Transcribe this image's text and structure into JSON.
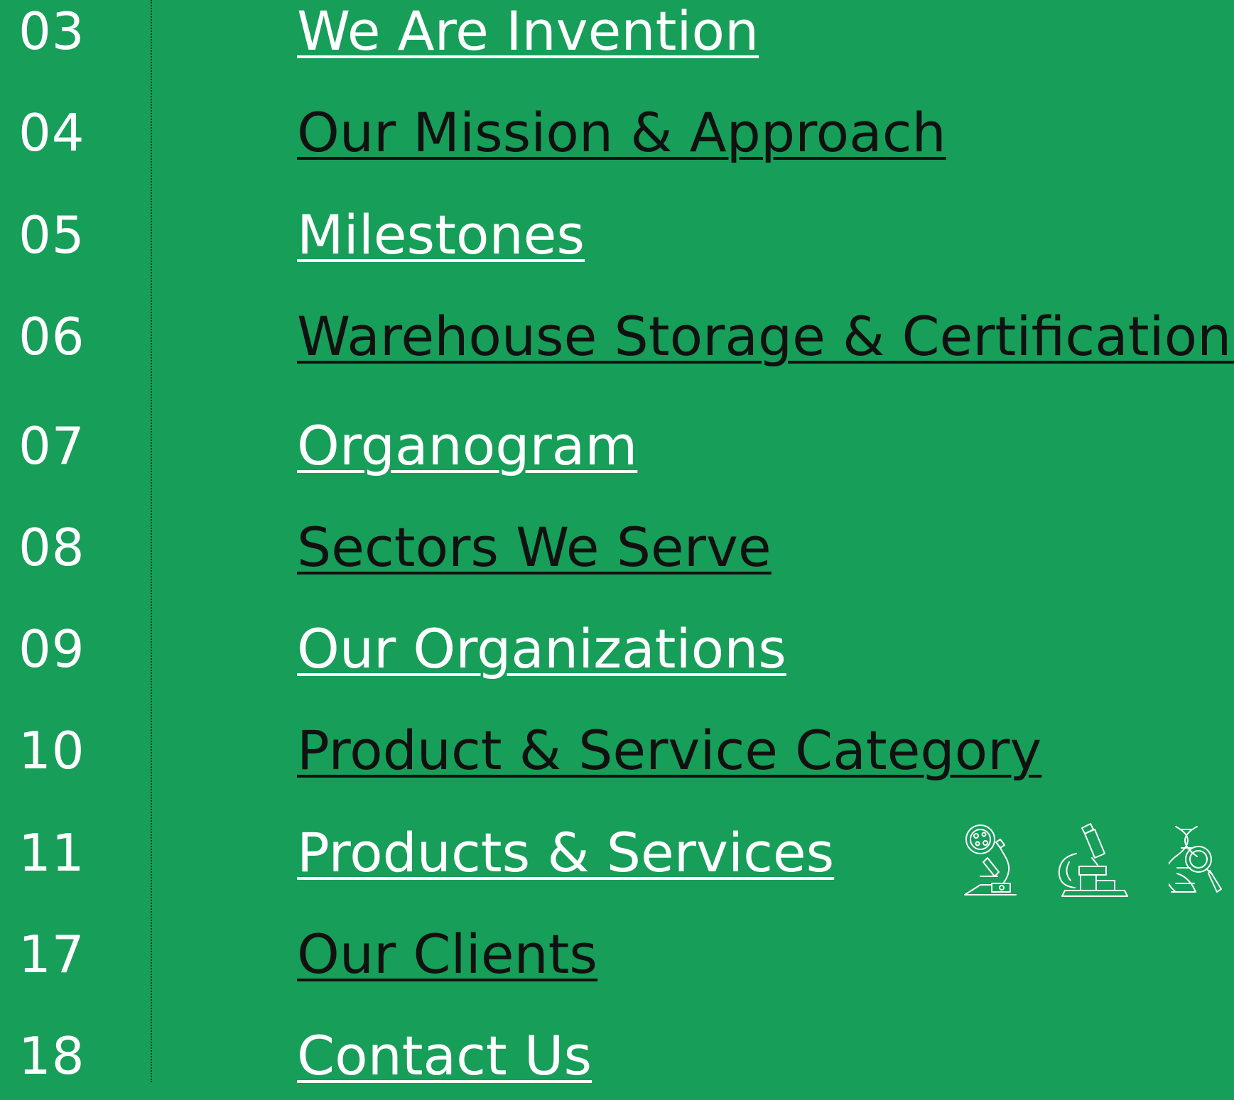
{
  "toc": {
    "entries": [
      {
        "page": "03",
        "title": "We Are Invention",
        "tone": "light"
      },
      {
        "page": "04",
        "title": "Our Mission & Approach",
        "tone": "dark"
      },
      {
        "page": "05",
        "title": "Milestones",
        "tone": "light"
      },
      {
        "page": "06",
        "title": "Warehouse Storage & Certifications",
        "tone": "dark"
      },
      {
        "page": "07",
        "title": "Organogram",
        "tone": "light"
      },
      {
        "page": "08",
        "title": "Sectors We Serve",
        "tone": "dark"
      },
      {
        "page": "09",
        "title": "Our Organizations",
        "tone": "light"
      },
      {
        "page": "10",
        "title": "Product & Service Category",
        "tone": "dark"
      },
      {
        "page": "11",
        "title": "Products & Services",
        "tone": "light"
      },
      {
        "page": "17",
        "title": "Our Clients",
        "tone": "dark"
      },
      {
        "page": "18",
        "title": "Contact Us",
        "tone": "light"
      }
    ]
  },
  "icons": [
    "microscope-petri-icon",
    "microscope-icon",
    "dna-magnifier-icon"
  ],
  "colors": {
    "background": "#179e59",
    "light_text": "#ffffff",
    "dark_text": "#111111"
  }
}
